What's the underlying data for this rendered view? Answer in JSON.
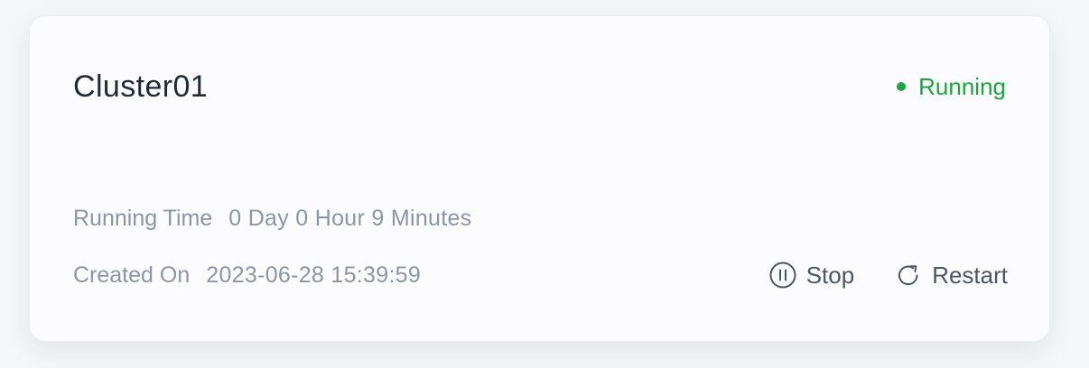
{
  "card": {
    "title": "Cluster01",
    "status": {
      "label": "Running",
      "color": "#19a63f"
    },
    "running_time": {
      "label": "Running Time",
      "value": "0 Day 0 Hour 9 Minutes"
    },
    "created_on": {
      "label": "Created On",
      "value": "2023-06-28 15:39:59"
    },
    "actions": [
      {
        "label": "Stop",
        "icon": "pause-circle-icon"
      },
      {
        "label": "Restart",
        "icon": "restart-icon"
      }
    ]
  }
}
